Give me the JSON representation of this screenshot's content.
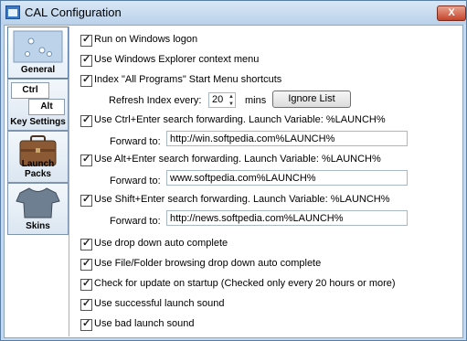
{
  "window": {
    "title": "CAL Configuration",
    "close_label": "X"
  },
  "sidebar": {
    "items": [
      {
        "label": "General"
      },
      {
        "label": "Key Settings",
        "key_top": "Ctrl",
        "key_bottom": "Alt"
      },
      {
        "label": "Launch Packs"
      },
      {
        "label": "Skins"
      }
    ]
  },
  "options": {
    "run_on_logon": "Run on Windows logon",
    "explorer_context": "Use Windows Explorer context menu",
    "index_shortcuts": "Index \"All Programs\" Start Menu shortcuts",
    "refresh_label": "Refresh Index every:",
    "refresh_value": "20",
    "refresh_unit": "mins",
    "ignore_button": "Ignore List",
    "ctrl_enter": "Use Ctrl+Enter search forwarding.  Launch Variable: %LAUNCH%",
    "ctrl_forward_label": "Forward to:",
    "ctrl_forward_value": "http://win.softpedia.com%LAUNCH%",
    "alt_enter": "Use Alt+Enter search forwarding.  Launch Variable: %LAUNCH%",
    "alt_forward_label": "Forward to:",
    "alt_forward_value": "www.softpedia.com%LAUNCH%",
    "shift_enter": "Use Shift+Enter search forwarding.  Launch Variable: %LAUNCH%",
    "shift_forward_label": "Forward to:",
    "shift_forward_value": "http://news.softpedia.com%LAUNCH%",
    "dropdown_autocomplete": "Use drop down auto complete",
    "filefolder_autocomplete": "Use File/Folder browsing drop down auto complete",
    "check_update": "Check for update on startup (Checked only every 20 hours or more)",
    "success_sound": "Use successful launch sound",
    "bad_sound": "Use bad launch sound"
  }
}
